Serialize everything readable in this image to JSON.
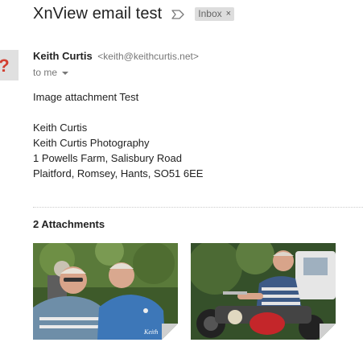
{
  "email": {
    "subject": "XnView email test",
    "label_chip": "Inbox",
    "label_remove": "×",
    "sender_name": "Keith Curtis",
    "sender_email": "<keith@keithcurtis.net>",
    "recipient": "to me",
    "avatar_glyph": "?",
    "body_lines": [
      "Image attachment Test",
      "",
      "Keith Curtis",
      "Keith Curtis Photography",
      "1 Powells Farm, Salisbury Road",
      "Plaitford, Romsey, Hants, SO51 6EE"
    ],
    "attachments_title": "2 Attachments",
    "attachment_watermark": "Keith"
  },
  "colors": {
    "label_chip_bg": "#dddddd",
    "avatar_bg": "#e0e0e0",
    "avatar_glyph": "#d23f31"
  }
}
